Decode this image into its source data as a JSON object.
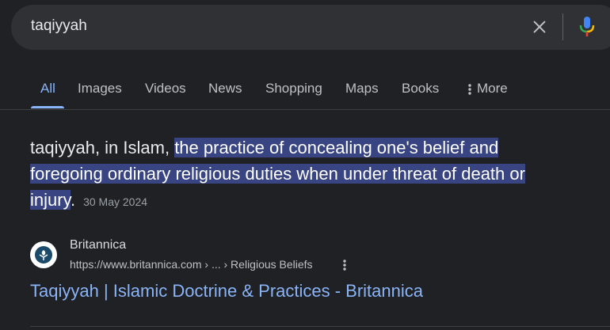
{
  "search": {
    "query": "taqiyyah"
  },
  "tabs": [
    {
      "label": "All",
      "active": true
    },
    {
      "label": "Images"
    },
    {
      "label": "Videos"
    },
    {
      "label": "News"
    },
    {
      "label": "Shopping"
    },
    {
      "label": "Maps"
    },
    {
      "label": "Books"
    },
    {
      "label": "More",
      "icon": "more-vert-icon"
    }
  ],
  "featured_snippet": {
    "lead": "taqiyyah, in Islam, ",
    "highlight_1": "the practice of concealing one's belief and",
    "highlight_2": "foregoing ordinary religious duties when under threat of death or",
    "highlight_3": "injury",
    "tail": ".",
    "date": "30 May 2024"
  },
  "source": {
    "name": "Britannica",
    "url": "https://www.britannica.com › ... › Religious Beliefs",
    "favicon": "britannica-thistle-icon"
  },
  "result": {
    "title": "Taqiyyah | Islamic Doctrine & Practices - Britannica"
  },
  "colors": {
    "background": "#202124",
    "searchbar": "#303134",
    "link": "#8ab4f8",
    "highlight": "#394582",
    "mic_blue": "#4285f4",
    "mic_red": "#ea4335",
    "mic_yellow": "#fbbc04",
    "mic_green": "#34a853"
  }
}
